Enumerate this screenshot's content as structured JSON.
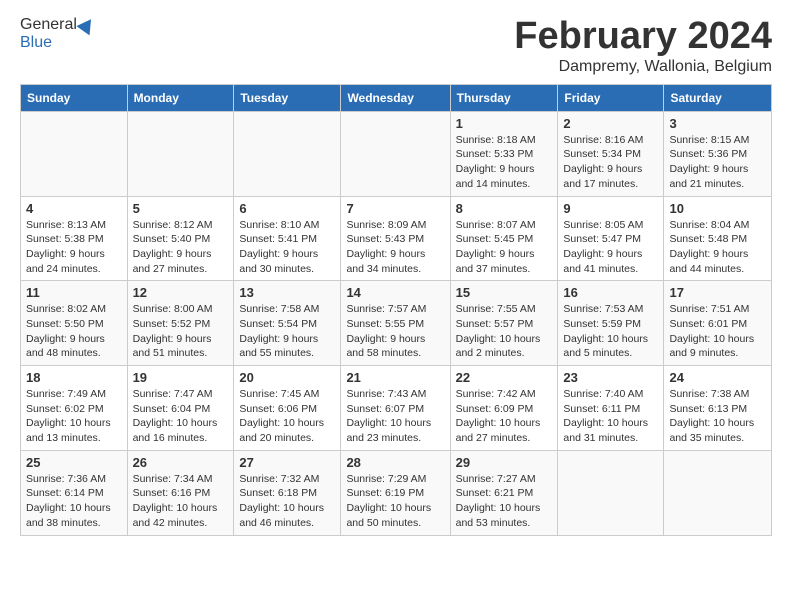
{
  "header": {
    "logo_general": "General",
    "logo_blue": "Blue",
    "month_title": "February 2024",
    "location": "Dampremy, Wallonia, Belgium"
  },
  "weekdays": [
    "Sunday",
    "Monday",
    "Tuesday",
    "Wednesday",
    "Thursday",
    "Friday",
    "Saturday"
  ],
  "weeks": [
    [
      {
        "day": "",
        "info": ""
      },
      {
        "day": "",
        "info": ""
      },
      {
        "day": "",
        "info": ""
      },
      {
        "day": "",
        "info": ""
      },
      {
        "day": "1",
        "info": "Sunrise: 8:18 AM\nSunset: 5:33 PM\nDaylight: 9 hours\nand 14 minutes."
      },
      {
        "day": "2",
        "info": "Sunrise: 8:16 AM\nSunset: 5:34 PM\nDaylight: 9 hours\nand 17 minutes."
      },
      {
        "day": "3",
        "info": "Sunrise: 8:15 AM\nSunset: 5:36 PM\nDaylight: 9 hours\nand 21 minutes."
      }
    ],
    [
      {
        "day": "4",
        "info": "Sunrise: 8:13 AM\nSunset: 5:38 PM\nDaylight: 9 hours\nand 24 minutes."
      },
      {
        "day": "5",
        "info": "Sunrise: 8:12 AM\nSunset: 5:40 PM\nDaylight: 9 hours\nand 27 minutes."
      },
      {
        "day": "6",
        "info": "Sunrise: 8:10 AM\nSunset: 5:41 PM\nDaylight: 9 hours\nand 30 minutes."
      },
      {
        "day": "7",
        "info": "Sunrise: 8:09 AM\nSunset: 5:43 PM\nDaylight: 9 hours\nand 34 minutes."
      },
      {
        "day": "8",
        "info": "Sunrise: 8:07 AM\nSunset: 5:45 PM\nDaylight: 9 hours\nand 37 minutes."
      },
      {
        "day": "9",
        "info": "Sunrise: 8:05 AM\nSunset: 5:47 PM\nDaylight: 9 hours\nand 41 minutes."
      },
      {
        "day": "10",
        "info": "Sunrise: 8:04 AM\nSunset: 5:48 PM\nDaylight: 9 hours\nand 44 minutes."
      }
    ],
    [
      {
        "day": "11",
        "info": "Sunrise: 8:02 AM\nSunset: 5:50 PM\nDaylight: 9 hours\nand 48 minutes."
      },
      {
        "day": "12",
        "info": "Sunrise: 8:00 AM\nSunset: 5:52 PM\nDaylight: 9 hours\nand 51 minutes."
      },
      {
        "day": "13",
        "info": "Sunrise: 7:58 AM\nSunset: 5:54 PM\nDaylight: 9 hours\nand 55 minutes."
      },
      {
        "day": "14",
        "info": "Sunrise: 7:57 AM\nSunset: 5:55 PM\nDaylight: 9 hours\nand 58 minutes."
      },
      {
        "day": "15",
        "info": "Sunrise: 7:55 AM\nSunset: 5:57 PM\nDaylight: 10 hours\nand 2 minutes."
      },
      {
        "day": "16",
        "info": "Sunrise: 7:53 AM\nSunset: 5:59 PM\nDaylight: 10 hours\nand 5 minutes."
      },
      {
        "day": "17",
        "info": "Sunrise: 7:51 AM\nSunset: 6:01 PM\nDaylight: 10 hours\nand 9 minutes."
      }
    ],
    [
      {
        "day": "18",
        "info": "Sunrise: 7:49 AM\nSunset: 6:02 PM\nDaylight: 10 hours\nand 13 minutes."
      },
      {
        "day": "19",
        "info": "Sunrise: 7:47 AM\nSunset: 6:04 PM\nDaylight: 10 hours\nand 16 minutes."
      },
      {
        "day": "20",
        "info": "Sunrise: 7:45 AM\nSunset: 6:06 PM\nDaylight: 10 hours\nand 20 minutes."
      },
      {
        "day": "21",
        "info": "Sunrise: 7:43 AM\nSunset: 6:07 PM\nDaylight: 10 hours\nand 23 minutes."
      },
      {
        "day": "22",
        "info": "Sunrise: 7:42 AM\nSunset: 6:09 PM\nDaylight: 10 hours\nand 27 minutes."
      },
      {
        "day": "23",
        "info": "Sunrise: 7:40 AM\nSunset: 6:11 PM\nDaylight: 10 hours\nand 31 minutes."
      },
      {
        "day": "24",
        "info": "Sunrise: 7:38 AM\nSunset: 6:13 PM\nDaylight: 10 hours\nand 35 minutes."
      }
    ],
    [
      {
        "day": "25",
        "info": "Sunrise: 7:36 AM\nSunset: 6:14 PM\nDaylight: 10 hours\nand 38 minutes."
      },
      {
        "day": "26",
        "info": "Sunrise: 7:34 AM\nSunset: 6:16 PM\nDaylight: 10 hours\nand 42 minutes."
      },
      {
        "day": "27",
        "info": "Sunrise: 7:32 AM\nSunset: 6:18 PM\nDaylight: 10 hours\nand 46 minutes."
      },
      {
        "day": "28",
        "info": "Sunrise: 7:29 AM\nSunset: 6:19 PM\nDaylight: 10 hours\nand 50 minutes."
      },
      {
        "day": "29",
        "info": "Sunrise: 7:27 AM\nSunset: 6:21 PM\nDaylight: 10 hours\nand 53 minutes."
      },
      {
        "day": "",
        "info": ""
      },
      {
        "day": "",
        "info": ""
      }
    ]
  ]
}
